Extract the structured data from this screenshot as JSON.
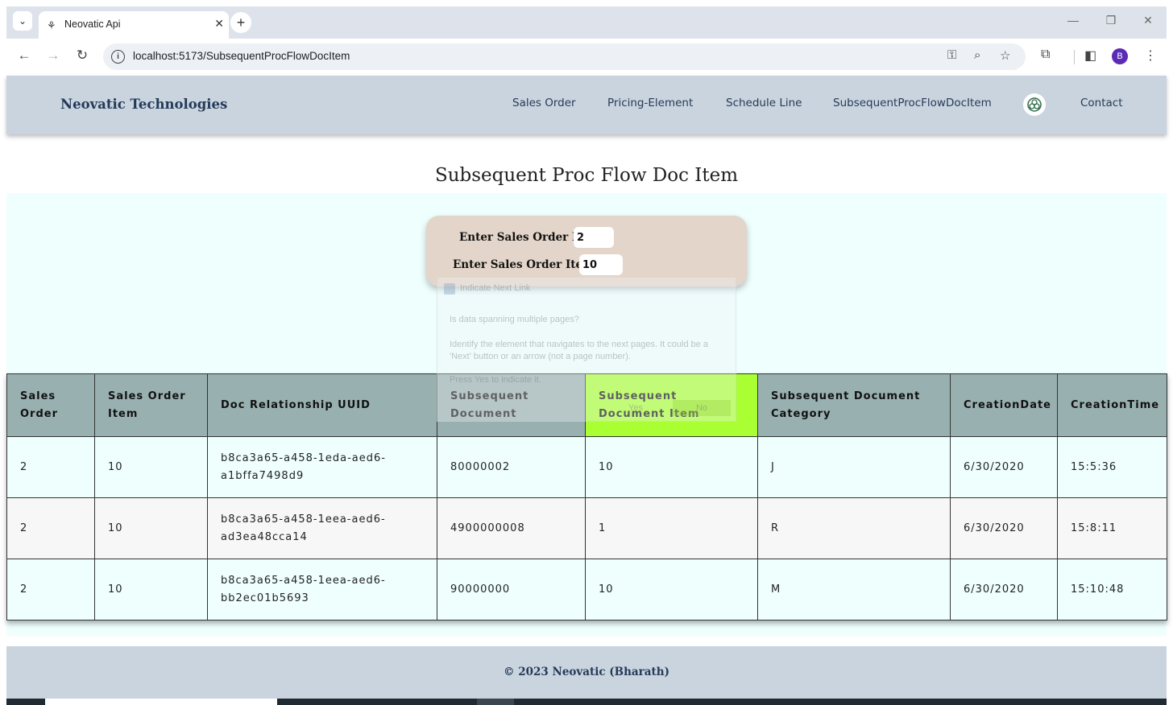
{
  "browser": {
    "tab_title": "Neovatic Api",
    "url": "localhost:5173/SubsequentProcFlowDocItem",
    "avatar_letter": "B"
  },
  "header": {
    "brand": "Neovatic Technologies",
    "nav": [
      "Sales Order",
      "Pricing-Element",
      "Schedule Line",
      "SubsequentProcFlowDocItem",
      "Contact"
    ]
  },
  "page": {
    "title": "Subsequent Proc Flow Doc Item"
  },
  "form": {
    "sales_order_label": "Enter Sales Order ID:",
    "sales_order_value": "2",
    "sales_order_item_label": "Enter Sales Order Item:",
    "sales_order_item_value": "10"
  },
  "overlay": {
    "title": "Indicate Next Link",
    "question": "Is data spanning multiple pages?",
    "description": "Identify the element that navigates to the next pages. It could be a 'Next' button or an arrow (not a page number).",
    "hint": "Press Yes to indicate it.",
    "yes_label": "Yes",
    "no_label": "No"
  },
  "table": {
    "headers": [
      "Sales Order",
      "Sales Order Item",
      "Doc Relationship UUID",
      "Subsequent Document",
      "Subsequent Document Item",
      "Subsequent Document Category",
      "CreationDate",
      "CreationTime"
    ],
    "rows": [
      [
        "2",
        "10",
        "b8ca3a65-a458-1eda-aed6-a1bffa7498d9",
        "80000002",
        "10",
        "J",
        "6/30/2020",
        "15:5:36"
      ],
      [
        "2",
        "10",
        "b8ca3a65-a458-1eea-aed6-ad3ea48cca14",
        "4900000008",
        "1",
        "R",
        "6/30/2020",
        "15:8:11"
      ],
      [
        "2",
        "10",
        "b8ca3a65-a458-1eea-aed6-bb2ec01b5693",
        "90000000",
        "10",
        "M",
        "6/30/2020",
        "15:10:48"
      ]
    ],
    "highlight_color": "#aaff33",
    "header_color": "#99b0b0"
  },
  "footer": {
    "text": "© 2023 Neovatic (Bharath)"
  }
}
